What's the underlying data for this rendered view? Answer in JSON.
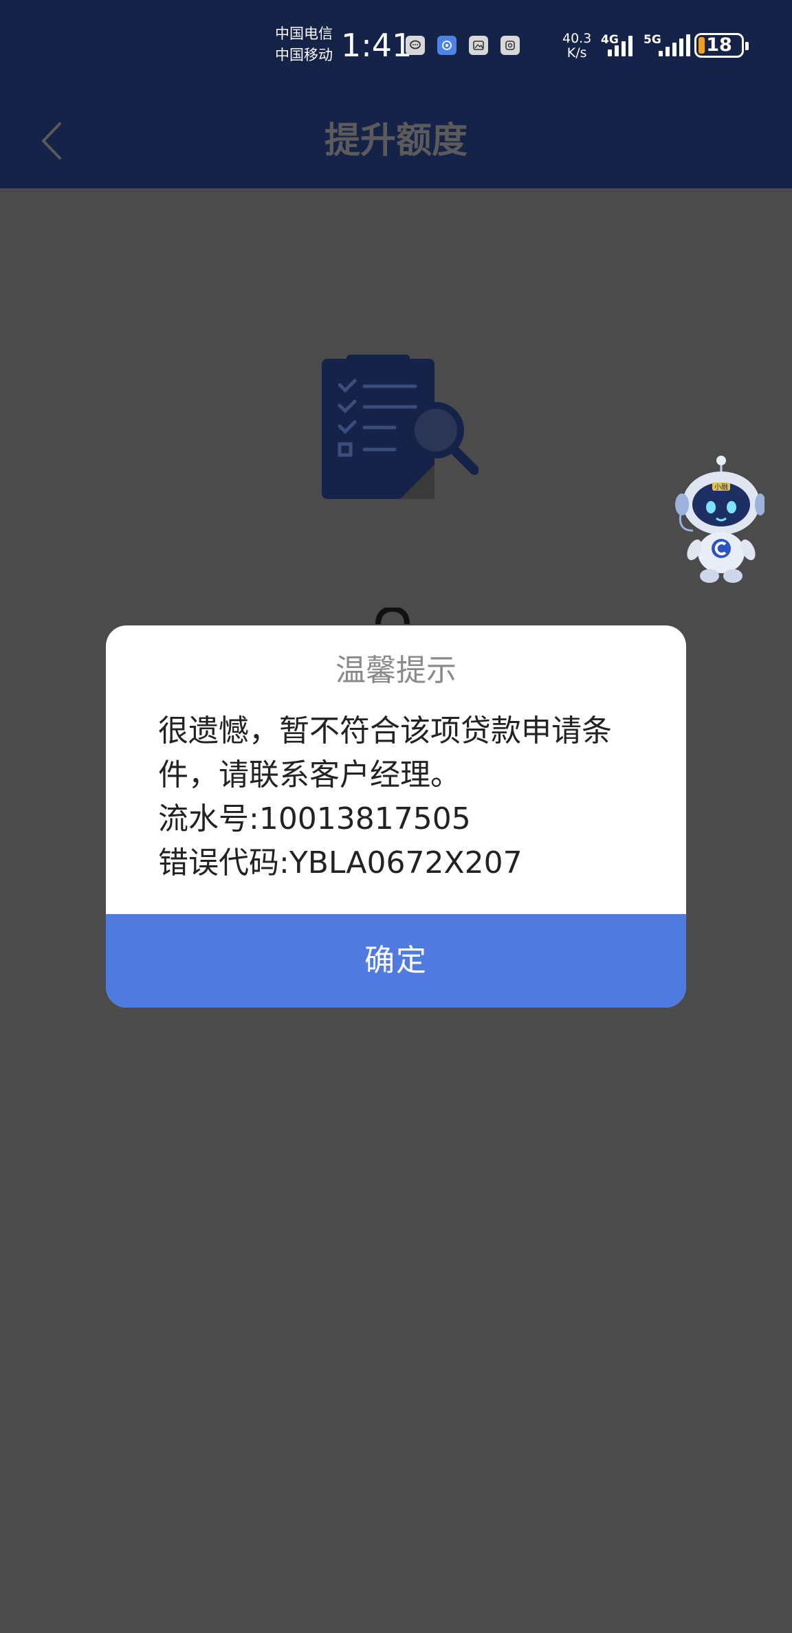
{
  "status_bar": {
    "carrier_1": "中国电信",
    "carrier_2": "中国移动",
    "time": "1:41",
    "net_speed_value": "40.3",
    "net_speed_unit": "K/s",
    "signal_1_label": "4G",
    "signal_2_label": "5G",
    "battery": "18",
    "battery_fill_color": "#f0a020",
    "notification_icons": [
      "message-icon",
      "location-icon",
      "image-icon",
      "app-icon"
    ]
  },
  "header": {
    "title": "提升额度",
    "back_icon": "chevron-left-icon"
  },
  "assistant": {
    "badge": "小融"
  },
  "dialog": {
    "title": "温馨提示",
    "message_line_1": "很遗憾，暂不符合该项贷款申请条",
    "message_line_2": "件，请联系客户经理。",
    "serial_line": "流水号:10013817505",
    "error_line": "错误代码:YBLA0672X207",
    "confirm_label": "确定"
  },
  "colors": {
    "header_bg": "#162348",
    "overlay_bg": "#4b4b4b",
    "confirm_bg": "#4f7be0"
  }
}
